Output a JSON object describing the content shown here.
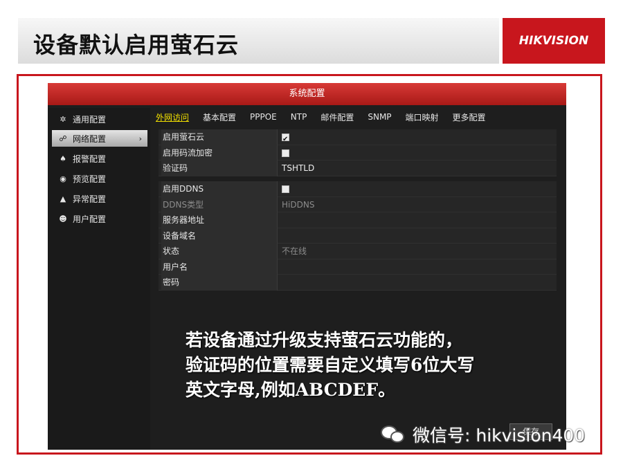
{
  "slide": {
    "title": "设备默认启用萤石云",
    "logo": "HIKVISION"
  },
  "window": {
    "title": "系统配置"
  },
  "sidebar": {
    "items": [
      {
        "label": "通用配置",
        "icon": "gear-icon"
      },
      {
        "label": "网络配置",
        "icon": "network-icon",
        "active": true
      },
      {
        "label": "报警配置",
        "icon": "alarm-icon"
      },
      {
        "label": "预览配置",
        "icon": "eye-icon"
      },
      {
        "label": "异常配置",
        "icon": "warning-icon"
      },
      {
        "label": "用户配置",
        "icon": "users-icon"
      }
    ],
    "preview_label": "预览"
  },
  "tabs": [
    "外网访问",
    "基本配置",
    "PPPOE",
    "NTP",
    "邮件配置",
    "SNMP",
    "端口映射",
    "更多配置"
  ],
  "ezviz": {
    "enable_label": "启用萤石云",
    "enable_checked": true,
    "stream_encrypt_label": "启用码流加密",
    "stream_encrypt_checked": false,
    "verify_code_label": "验证码",
    "verify_code_value": "TSHTLD"
  },
  "ddns": {
    "enable_label": "启用DDNS",
    "enable_checked": false,
    "type_label": "DDNS类型",
    "type_value": "HiDDNS",
    "server_label": "服务器地址",
    "domain_label": "设备域名",
    "status_label": "状态",
    "status_value": "不在线",
    "user_label": "用户名",
    "password_label": "密码"
  },
  "overlay": {
    "line1": "若设备通过升级支持萤石云功能的，",
    "line2": "验证码的位置需要自定义填写6位大写",
    "line3": "英文字母,例如ABCDEF。"
  },
  "save_label": "保存",
  "watermark": "微信号: hikvision400"
}
